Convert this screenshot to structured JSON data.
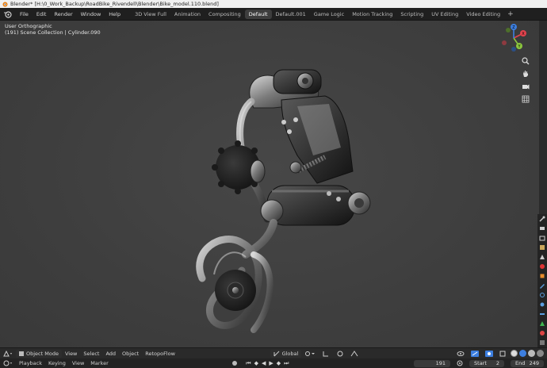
{
  "window": {
    "title": "Blender* [H:\\0_Work_Backup\\RoadBike_Rivendell\\Blender\\Bike_model.110.blend]"
  },
  "menus": [
    "File",
    "Edit",
    "Render",
    "Window",
    "Help"
  ],
  "workspaces": {
    "tabs": [
      "3D View Full",
      "Animation",
      "Compositing",
      "Default",
      "Default.001",
      "Game Logic",
      "Motion Tracking",
      "Scripting",
      "UV Editing",
      "Video Editing"
    ],
    "active": "Default",
    "add_label": "+"
  },
  "viewport": {
    "view_name": "User Orthographic",
    "collection_info": "(191) Scene Collection | Cylinder.090"
  },
  "gizmo": {
    "x": "X",
    "y": "Y",
    "z": "Z",
    "colors": {
      "x": "#e2434d",
      "y": "#8bc63e",
      "z": "#3d7fe0"
    }
  },
  "header": {
    "mode": "Object Mode",
    "menus": [
      "View",
      "Select",
      "Add",
      "Object",
      "RetopoFlow"
    ],
    "transform_orientation": "Global"
  },
  "timeline": {
    "menus": [
      "Playback",
      "Keying",
      "View",
      "Marker"
    ],
    "current_frame": "191",
    "start_label": "Start",
    "start": "2",
    "end_label": "End",
    "end": "249"
  },
  "icons": {
    "nav": [
      "zoom-icon",
      "pan-hand-icon",
      "camera-icon",
      "grid-icon"
    ],
    "props": [
      "tool-icon",
      "render-icon",
      "output-icon",
      "view-layer-icon",
      "scene-icon",
      "world-icon",
      "object-icon",
      "modifier-icon",
      "particles-icon",
      "physics-icon",
      "constraints-icon",
      "data-icon",
      "material-icon",
      "texture-icon"
    ]
  }
}
